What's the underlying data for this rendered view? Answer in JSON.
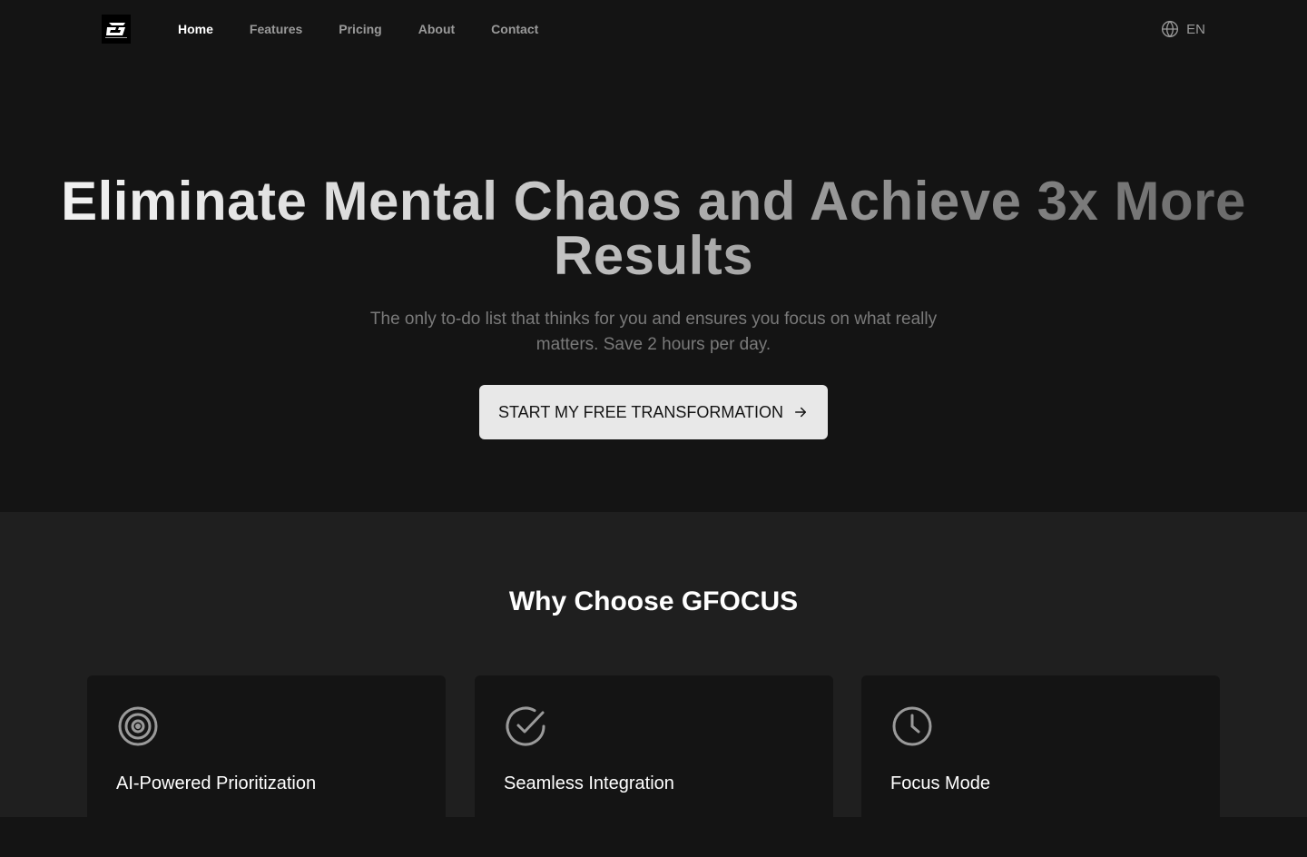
{
  "nav": {
    "logo_alt": "GFOCUS logo",
    "links": [
      {
        "label": "Home",
        "active": true
      },
      {
        "label": "Features",
        "active": false
      },
      {
        "label": "Pricing",
        "active": false
      },
      {
        "label": "About",
        "active": false
      },
      {
        "label": "Contact",
        "active": false
      }
    ],
    "language": {
      "icon": "globe-icon",
      "label": "EN"
    }
  },
  "hero": {
    "title": "Eliminate Mental Chaos and Achieve 3x More Results",
    "subtitle": "The only to-do list that thinks for you and ensures you focus on what really matters. Save 2 hours per day.",
    "cta_label": "START MY FREE TRANSFORMATION",
    "cta_icon": "arrow-right-icon"
  },
  "features": {
    "title": "Why Choose GFOCUS",
    "cards": [
      {
        "icon": "target-icon",
        "title": "AI-Powered Prioritization",
        "description": ""
      },
      {
        "icon": "check-circle-icon",
        "title": "Seamless Integration",
        "description": ""
      },
      {
        "icon": "clock-icon",
        "title": "Focus Mode",
        "description": ""
      }
    ]
  },
  "colors": {
    "background": "#141414",
    "section_background": "#1f1f1f",
    "card_background": "#141414",
    "cta_background": "#e8e8e8",
    "muted_text": "#7a7a7a",
    "nav_inactive": "#9a9a9a"
  }
}
